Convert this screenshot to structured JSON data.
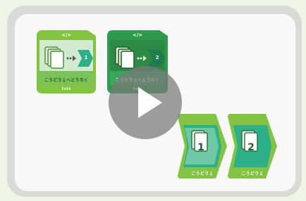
{
  "blocks": [
    {
      "code_icon": "</>",
      "label": "こうどう１へとうろく",
      "brand": "tolo",
      "target_number": "1"
    },
    {
      "code_icon": "</>",
      "label": "こうどう２へとうろく",
      "brand": "tolo",
      "target_number": "2"
    }
  ],
  "actions": [
    {
      "number": "1",
      "label": "こうどう１"
    },
    {
      "number": "2",
      "label": "こうどう２"
    }
  ],
  "colors": {
    "light_green": "#82c341",
    "dark_green": "#2f9a4e",
    "teal": "#2db08a",
    "page_bg": "#eef5e4"
  },
  "icons": [
    "code-icon",
    "card-stack-icon",
    "arrow-icon",
    "play-icon"
  ]
}
